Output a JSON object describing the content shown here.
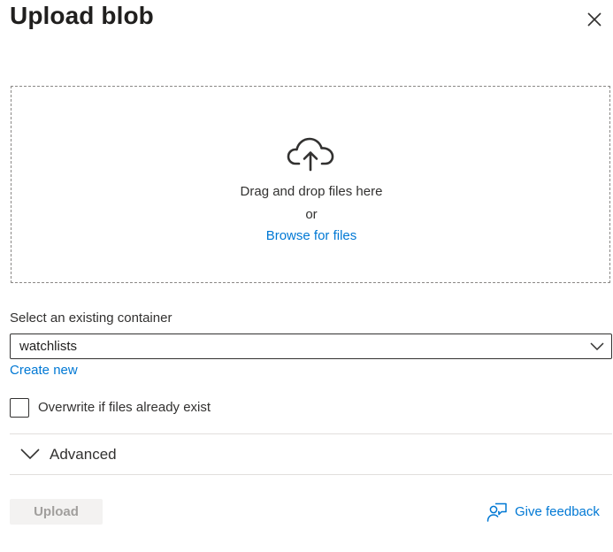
{
  "panel": {
    "title": "Upload blob"
  },
  "dropzone": {
    "icon": "cloud-upload-icon",
    "main_text": "Drag and drop files here",
    "or_text": "or",
    "browse_link": "Browse for files"
  },
  "container": {
    "label": "Select an existing container",
    "selected": "watchlists",
    "create_new": "Create new"
  },
  "overwrite": {
    "label": "Overwrite if files already exist",
    "checked": false
  },
  "advanced": {
    "label": "Advanced",
    "expanded": false
  },
  "footer": {
    "upload_label": "Upload",
    "feedback_label": "Give feedback"
  },
  "colors": {
    "accent": "#0078d4",
    "text": "#323130",
    "disabled_bg": "#f3f2f1",
    "disabled_text": "#a19f9d"
  }
}
